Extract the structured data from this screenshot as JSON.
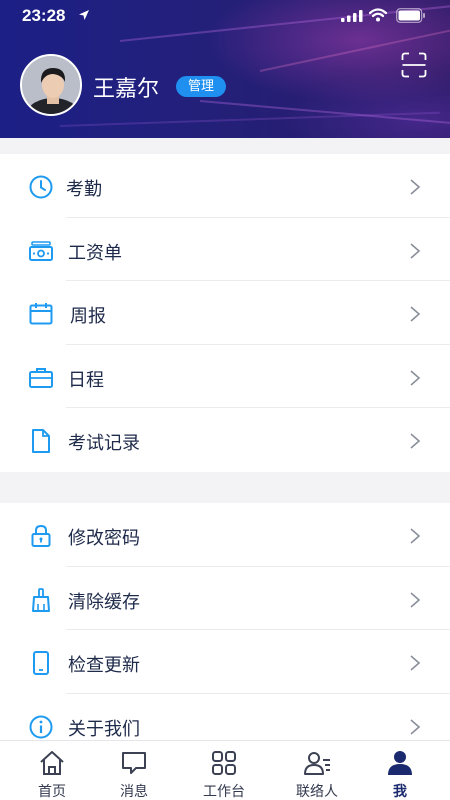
{
  "status_bar": {
    "time": "23:28"
  },
  "profile": {
    "name": "王嘉尔",
    "role_badge": "管理"
  },
  "menu_group_1": [
    {
      "label": "考勤",
      "icon": "clock-icon"
    },
    {
      "label": "工资单",
      "icon": "payslip-icon"
    },
    {
      "label": "周报",
      "icon": "calendar-icon"
    },
    {
      "label": "日程",
      "icon": "briefcase-icon"
    },
    {
      "label": "考试记录",
      "icon": "document-icon"
    }
  ],
  "menu_group_2": [
    {
      "label": "修改密码",
      "icon": "lock-icon"
    },
    {
      "label": "清除缓存",
      "icon": "brush-icon"
    },
    {
      "label": "检查更新",
      "icon": "phone-icon"
    },
    {
      "label": "关于我们",
      "icon": "info-icon"
    }
  ],
  "tabbar": [
    {
      "label": "首页",
      "icon": "home-icon"
    },
    {
      "label": "消息",
      "icon": "message-icon"
    },
    {
      "label": "工作台",
      "icon": "grid-icon"
    },
    {
      "label": "联络人",
      "icon": "contacts-icon"
    },
    {
      "label": "我",
      "icon": "person-icon",
      "active": true
    }
  ],
  "colors": {
    "accent": "#1e9bf0",
    "badge": "#1f8ff0",
    "header_dark": "#1c1f86",
    "active_tab": "#1b2a6e"
  }
}
